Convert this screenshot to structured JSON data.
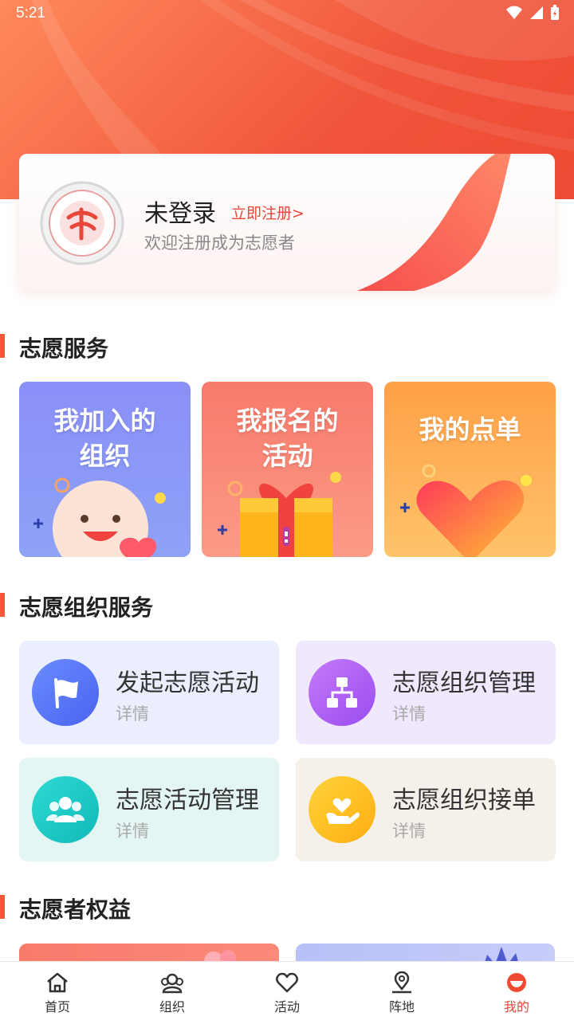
{
  "status_bar": {
    "time": "5:21"
  },
  "profile": {
    "avatar_name": "volunteer-emblem",
    "login_status": "未登录",
    "register_link": "立即注册>",
    "welcome_text": "欢迎注册成为志愿者"
  },
  "sections": {
    "volunteer_service": "志愿服务",
    "org_service": "志愿组织服务",
    "benefits": "志愿者权益"
  },
  "service_tiles": [
    {
      "line1": "我加入的",
      "line2": "组织",
      "icon": "smiley-face-icon"
    },
    {
      "line1": "我报名的",
      "line2": "活动",
      "icon": "gift-box-icon"
    },
    {
      "line1": "我的点单",
      "line2": "",
      "icon": "heart-icon"
    }
  ],
  "org_cards": [
    {
      "title": "发起志愿活动",
      "subtitle": "详情",
      "icon": "flag-icon"
    },
    {
      "title": "志愿组织管理",
      "subtitle": "详情",
      "icon": "org-chart-icon"
    },
    {
      "title": "志愿活动管理",
      "subtitle": "详情",
      "icon": "people-icon"
    },
    {
      "title": "志愿组织接单",
      "subtitle": "详情",
      "icon": "hand-heart-icon"
    }
  ],
  "tabs": [
    {
      "label": "首页",
      "icon": "home-icon",
      "active": false
    },
    {
      "label": "组织",
      "icon": "group-icon",
      "active": false
    },
    {
      "label": "活动",
      "icon": "heart-outline-icon",
      "active": false
    },
    {
      "label": "阵地",
      "icon": "location-pin-icon",
      "active": false
    },
    {
      "label": "我的",
      "icon": "profile-icon",
      "active": true
    }
  ],
  "colors": {
    "accent": "#e8473a",
    "hero_start": "#ff8a5c",
    "hero_end": "#ef4a33",
    "tile_purple": "#8a8ff7",
    "tile_coral": "#f87a6b",
    "tile_orange": "#ffb15a"
  }
}
